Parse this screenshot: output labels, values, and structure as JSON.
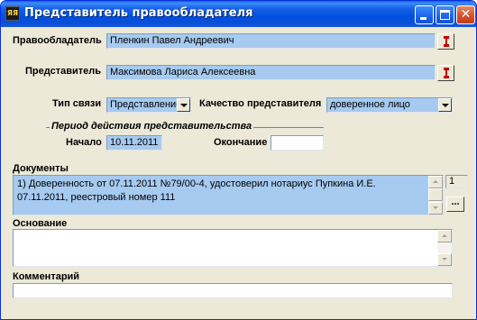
{
  "window": {
    "title": "Представитель правообладателя",
    "app_icon_text": "ЯЯ",
    "close_glyph": "✕"
  },
  "copyright_holder": {
    "label": "Правообладатель",
    "value": "Пленкин Павел Андреевич"
  },
  "representative": {
    "label": "Представитель",
    "value": "Максимова Лариса Алексеевна"
  },
  "relation_type": {
    "label": "Тип связи",
    "selected": "Представление"
  },
  "representative_quality": {
    "label": "Качество представителя",
    "selected": "доверенное лицо"
  },
  "validity_period": {
    "group_title": "Период действия представительства",
    "start_label": "Начало",
    "start_value": "10.11.2011",
    "end_label": "Окончание",
    "end_value": ""
  },
  "documents": {
    "label": "Документы",
    "text": "1) Доверенность от 07.11.2011 №79/00-4, удостоверил нотариус Пупкина И.Е. 07.11.2011, реестровый номер 111",
    "count": "1",
    "browse_label": "..."
  },
  "basis": {
    "label": "Основание",
    "text": ""
  },
  "comment": {
    "label": "Комментарий",
    "value": ""
  },
  "icons": {
    "pick": "pick-person-icon",
    "minimize": "minimize-icon",
    "maximize": "maximize-icon",
    "close": "close-icon",
    "dropdown": "chevron-down-icon"
  }
}
